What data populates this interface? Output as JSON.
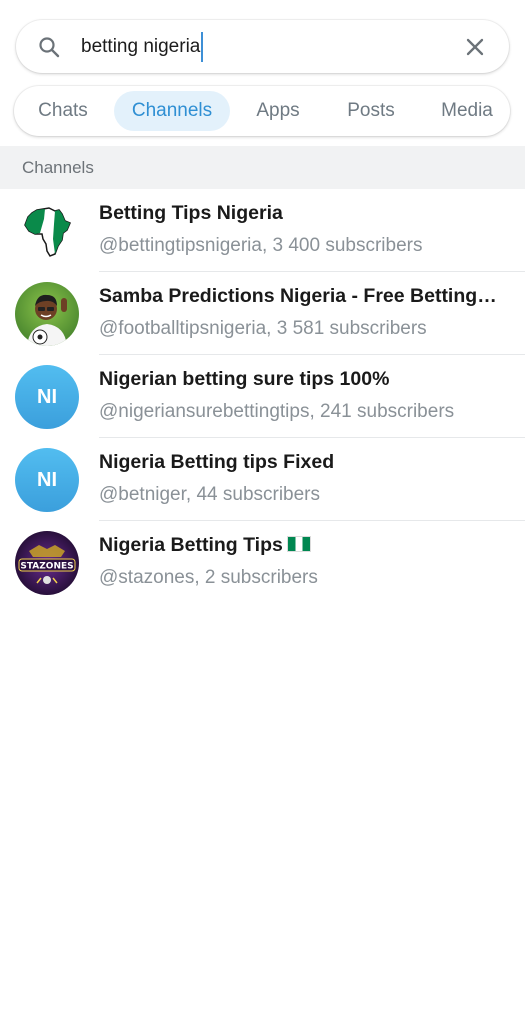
{
  "search": {
    "query": "betting nigeria",
    "icon": "search-icon",
    "clear_icon": "close-icon"
  },
  "tabs": [
    {
      "label": "Chats",
      "active": false
    },
    {
      "label": "Channels",
      "active": true
    },
    {
      "label": "Apps",
      "active": false
    },
    {
      "label": "Posts",
      "active": false
    },
    {
      "label": "Media",
      "active": false
    }
  ],
  "section": {
    "title": "Channels"
  },
  "channels": [
    {
      "title": "Betting Tips Nigeria",
      "subtitle": "@bettingtipsnigeria, 3 400 subscribers",
      "avatar": "africa-map-flag"
    },
    {
      "title": "Samba Predictions Nigeria - Free Betting Tips",
      "subtitle": "@footballtipsnigeria, 3 581 subscribers",
      "avatar": "footballer-cartoon"
    },
    {
      "title": "Nigerian betting sure tips 100%",
      "subtitle": "@nigeriansurebettingtips, 241 subscribers",
      "avatar": "NI"
    },
    {
      "title": "Nigeria Betting tips Fixed",
      "subtitle": "@betniger, 44 subscribers",
      "avatar": "NI"
    },
    {
      "title": "Nigeria Betting Tips",
      "subtitle": "@stazones, 2 subscribers",
      "avatar": "stazones-logo",
      "avatar_text": "STAZONES",
      "title_emoji": "nigeria-flag"
    }
  ],
  "colors": {
    "accent": "#2f8fd3",
    "active_tab_bg": "#e3f1fb",
    "initials_avatar": "#3b9fdc",
    "nigeria_green": "#008751"
  }
}
